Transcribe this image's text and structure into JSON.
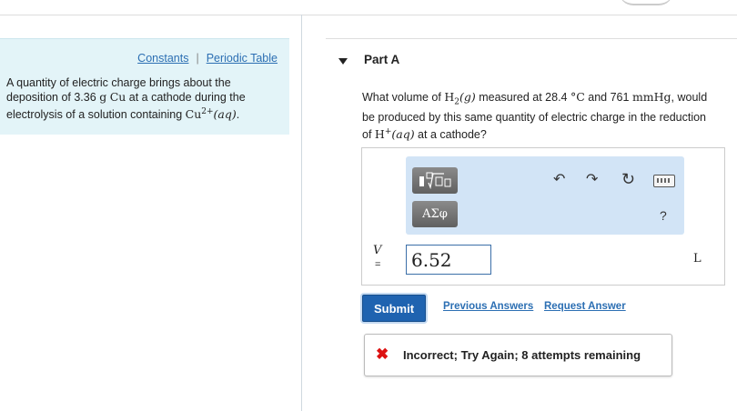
{
  "links": {
    "constants": "Constants",
    "separator": "|",
    "periodic_table": "Periodic Table"
  },
  "problem": {
    "part1": "A quantity of electric charge brings about the deposition of ",
    "mass": "3.36",
    "unit_g": "g",
    "element": "Cu",
    "part2": " at a cathode during the electrolysis of a solution containing ",
    "ion": "Cu",
    "ion_charge": "2+",
    "state": "(aq)",
    "end": "."
  },
  "part": {
    "title": "Part A"
  },
  "question": {
    "q1": "What volume of ",
    "gas": "H",
    "gas_sub": "2",
    "gas_state": "(g)",
    "q2": " measured at 28.4 ",
    "deg": "°C",
    "q3": " and 761 ",
    "pressure_unit": "mmHg",
    "q4": ", would be produced by this same quantity of electric charge in the reduction of ",
    "ion": "H",
    "ion_charge": "+",
    "ion_state": "(aq)",
    "q5": " at a cathode?"
  },
  "toolbar": {
    "template_icon": "template-icon",
    "greek_label": "ΑΣφ",
    "undo_icon": "undo-icon",
    "redo_icon": "redo-icon",
    "reset_icon": "reset-icon",
    "keyboard_icon": "keyboard-icon",
    "help_label": "?"
  },
  "answer": {
    "variable": "V",
    "equals": "=",
    "value": "6.52",
    "unit": "L"
  },
  "actions": {
    "submit": "Submit",
    "previous_answers": "Previous Answers",
    "request_answer": "Request Answer"
  },
  "feedback": {
    "icon": "x-icon",
    "message": "Incorrect; Try Again; 8 attempts remaining"
  },
  "colors": {
    "panel_bg": "#e3f4f8",
    "toolbar_bg": "#d2e4f6",
    "submit_bg": "#1f63b0",
    "link": "#2c6fb3",
    "error": "#dd1111"
  }
}
